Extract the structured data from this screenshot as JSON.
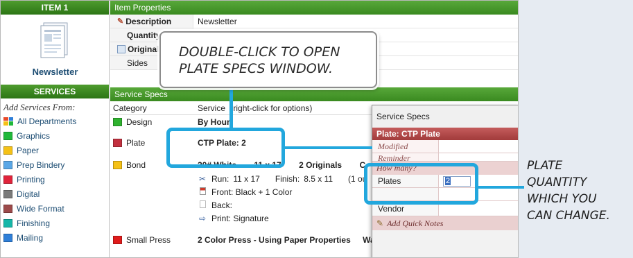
{
  "item": {
    "header": "ITEM 1",
    "name": "Newsletter"
  },
  "properties": {
    "bar_title": "Item Properties",
    "rows": [
      {
        "label": "Description",
        "value": "Newsletter"
      },
      {
        "label": "Quantity",
        "value": ""
      },
      {
        "label": "Originals",
        "value": ""
      },
      {
        "label": "Sides",
        "value": ""
      }
    ]
  },
  "services": {
    "header": "SERVICES",
    "add_from": "Add Services From:",
    "departments": [
      {
        "label": "All Departments",
        "color": "#e84a2a"
      },
      {
        "label": "Graphics",
        "color": "#20b83a"
      },
      {
        "label": "Paper",
        "color": "#f5c116"
      },
      {
        "label": "Prep Bindery",
        "color": "#5aa7e6"
      },
      {
        "label": "Printing",
        "color": "#e0233a"
      },
      {
        "label": "Digital",
        "color": "#7a7a7a"
      },
      {
        "label": "Wide Format",
        "color": "#9c4a4a"
      },
      {
        "label": "Finishing",
        "color": "#16b6a8"
      },
      {
        "label": "Mailing",
        "color": "#2f7fd8"
      }
    ]
  },
  "service_specs": {
    "bar_title": "Service Specs",
    "col_category": "Category",
    "col_service": "Service",
    "col_service_hint": "(right-click for options)",
    "rows": [
      {
        "category": "Design",
        "color": "#2fb22f",
        "service": "By Hour"
      },
      {
        "category": "Plate",
        "color": "#c2303f",
        "service": "CTP Plate:  2"
      },
      {
        "category": "Bond",
        "color": "#f5c116",
        "service": "20# White",
        "size": "11 x 17",
        "originals": "2 Originals",
        "extra": "C"
      },
      {
        "category": "Small Press",
        "color": "#e01b1b",
        "service": "2 Color Press - Using Paper Properties",
        "extra": "Wa"
      }
    ],
    "bond_details": {
      "run_label": "Run:",
      "run_value": "11 x 17",
      "finish_label": "Finish:",
      "finish_value": "8.5 x 11",
      "finish_extra": "(1 ou",
      "front": "Front: Black + 1 Color",
      "back": "Back:",
      "print": "Print: Signature"
    }
  },
  "popup": {
    "title": "Service Specs",
    "header": "Plate: CTP Plate",
    "field_modified": "Modified",
    "field_reminder": "Reminder",
    "section_how_many": "How many?",
    "plates_label": "Plates",
    "plates_value": "2",
    "vendor_label": "Vendor",
    "quick_notes": "Add Quick Notes"
  },
  "annotations": {
    "callout_line1": "DOUBLE-CLICK TO OPEN",
    "callout_line2": "PLATE SPECS WINDOW.",
    "side_line1": "PLATE",
    "side_line2": "QUANTITY",
    "side_line3": "WHICH YOU",
    "side_line4": "CAN CHANGE.",
    "highlight_color": "#22a7dd"
  }
}
